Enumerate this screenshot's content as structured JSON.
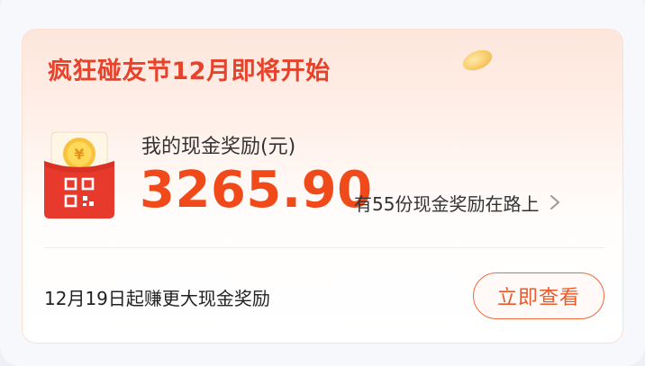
{
  "promo": {
    "title": "疯狂碰友节12月即将开始"
  },
  "reward": {
    "label": "我的现金奖励(元)",
    "amount": "3265.90",
    "pending_text": "有55份现金奖励在路上"
  },
  "footer": {
    "text": "12月19日起赚更大现金奖励",
    "button_label": "立即查看"
  },
  "icons": {
    "envelope": "red-envelope-coin-icon",
    "chevron": "chevron-right-icon",
    "decoration": "gold-coin-icon"
  },
  "colors": {
    "accent": "#e8422b",
    "amount": "#f04a1a",
    "button_border": "#ee6a3c"
  }
}
